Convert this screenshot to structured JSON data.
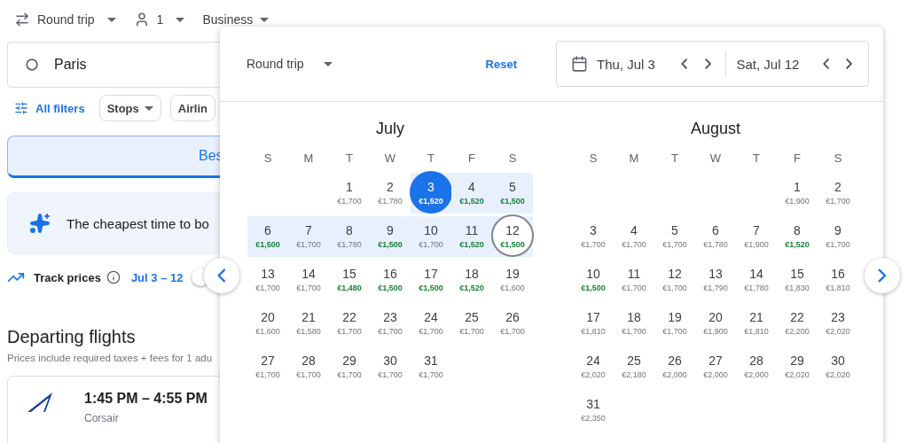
{
  "top_bar": {
    "trip_type": "Round trip",
    "passengers": "1",
    "cabin": "Business"
  },
  "search": {
    "origin": "Paris"
  },
  "filters": {
    "all_filters": "All filters",
    "chips": [
      "Stops",
      "Airlin"
    ]
  },
  "sort_tabs": [
    {
      "label": "Bes",
      "selected": true
    }
  ],
  "insight": {
    "text": "The cheapest time to bo"
  },
  "track": {
    "label": "Track prices",
    "dates": "Jul 3 – 12",
    "on": false
  },
  "departing": {
    "title": "Departing flights",
    "note": "Prices include required taxes + fees for 1 adu"
  },
  "flights": [
    {
      "times": "1:45 PM – 4:55 PM",
      "airline": "Corsair"
    }
  ],
  "dialog": {
    "trip_type": "Round trip",
    "reset": "Reset",
    "departure": "Thu, Jul 3",
    "return": "Sat, Jul 12",
    "months": [
      {
        "name": "July",
        "weekdays": [
          "S",
          "M",
          "T",
          "W",
          "T",
          "F",
          "S"
        ],
        "weeks": [
          {
            "leading_gap": true,
            "days": [
              {
                "day": "1",
                "price": "€1,700",
                "low": false,
                "in_range": false,
                "selected": false,
                "outlined": false
              },
              {
                "day": "2",
                "price": "€1,780",
                "low": false,
                "in_range": false,
                "selected": false,
                "outlined": false
              },
              {
                "day": "3",
                "price": "€1,520",
                "low": true,
                "in_range": true,
                "selected": true,
                "outlined": false
              },
              {
                "day": "4",
                "price": "€1,520",
                "low": true,
                "in_range": true,
                "selected": false,
                "outlined": false
              },
              {
                "day": "5",
                "price": "€1,500",
                "low": true,
                "in_range": true,
                "selected": false,
                "outlined": false
              }
            ]
          },
          {
            "days": [
              {
                "day": "6",
                "price": "€1,500",
                "low": true,
                "in_range": true,
                "selected": false,
                "outlined": false
              },
              {
                "day": "7",
                "price": "€1,700",
                "low": false,
                "in_range": true,
                "selected": false,
                "outlined": false
              },
              {
                "day": "8",
                "price": "€1,780",
                "low": false,
                "in_range": true,
                "selected": false,
                "outlined": false
              },
              {
                "day": "9",
                "price": "€1,500",
                "low": true,
                "in_range": true,
                "selected": false,
                "outlined": false
              },
              {
                "day": "10",
                "price": "€1,700",
                "low": false,
                "in_range": true,
                "selected": false,
                "outlined": false
              },
              {
                "day": "11",
                "price": "€1,520",
                "low": true,
                "in_range": true,
                "selected": false,
                "outlined": false
              },
              {
                "day": "12",
                "price": "€1,500",
                "low": true,
                "in_range": true,
                "selected": false,
                "outlined": true
              }
            ]
          },
          {
            "days": [
              {
                "day": "13",
                "price": "€1,700",
                "low": false,
                "in_range": false,
                "selected": false,
                "outlined": false
              },
              {
                "day": "14",
                "price": "€1,700",
                "low": false,
                "in_range": false,
                "selected": false,
                "outlined": false
              },
              {
                "day": "15",
                "price": "€1,480",
                "low": true,
                "in_range": false,
                "selected": false,
                "outlined": false
              },
              {
                "day": "16",
                "price": "€1,500",
                "low": true,
                "in_range": false,
                "selected": false,
                "outlined": false
              },
              {
                "day": "17",
                "price": "€1,500",
                "low": true,
                "in_range": false,
                "selected": false,
                "outlined": false
              },
              {
                "day": "18",
                "price": "€1,520",
                "low": true,
                "in_range": false,
                "selected": false,
                "outlined": false
              },
              {
                "day": "19",
                "price": "€1,600",
                "low": false,
                "in_range": false,
                "selected": false,
                "outlined": false
              }
            ]
          },
          {
            "days": [
              {
                "day": "20",
                "price": "€1,600",
                "low": false,
                "in_range": false,
                "selected": false,
                "outlined": false
              },
              {
                "day": "21",
                "price": "€1,580",
                "low": false,
                "in_range": false,
                "selected": false,
                "outlined": false
              },
              {
                "day": "22",
                "price": "€1,700",
                "low": false,
                "in_range": false,
                "selected": false,
                "outlined": false
              },
              {
                "day": "23",
                "price": "€1,700",
                "low": false,
                "in_range": false,
                "selected": false,
                "outlined": false
              },
              {
                "day": "24",
                "price": "€1,700",
                "low": false,
                "in_range": false,
                "selected": false,
                "outlined": false
              },
              {
                "day": "25",
                "price": "€1,700",
                "low": false,
                "in_range": false,
                "selected": false,
                "outlined": false
              },
              {
                "day": "26",
                "price": "€1,700",
                "low": false,
                "in_range": false,
                "selected": false,
                "outlined": false
              }
            ]
          },
          {
            "leading_gap": false,
            "days": [
              {
                "day": "27",
                "price": "€1,700",
                "low": false,
                "in_range": false,
                "selected": false,
                "outlined": false
              },
              {
                "day": "28",
                "price": "€1,700",
                "low": false,
                "in_range": false,
                "selected": false,
                "outlined": false
              },
              {
                "day": "29",
                "price": "€1,700",
                "low": false,
                "in_range": false,
                "selected": false,
                "outlined": false
              },
              {
                "day": "30",
                "price": "€1,700",
                "low": false,
                "in_range": false,
                "selected": false,
                "outlined": false
              },
              {
                "day": "31",
                "price": "€1,700",
                "low": false,
                "in_range": false,
                "selected": false,
                "outlined": false
              }
            ]
          }
        ]
      },
      {
        "name": "August",
        "weekdays": [
          "S",
          "M",
          "T",
          "W",
          "T",
          "F",
          "S"
        ],
        "weeks": [
          {
            "leading_gap": true,
            "days": [
              {
                "day": "1",
                "price": "€1,900",
                "low": false,
                "in_range": false,
                "selected": false,
                "outlined": false
              },
              {
                "day": "2",
                "price": "€1,700",
                "low": false,
                "in_range": false,
                "selected": false,
                "outlined": false
              }
            ]
          },
          {
            "days": [
              {
                "day": "3",
                "price": "€1,700",
                "low": false,
                "in_range": false,
                "selected": false,
                "outlined": false
              },
              {
                "day": "4",
                "price": "€1,700",
                "low": false,
                "in_range": false,
                "selected": false,
                "outlined": false
              },
              {
                "day": "5",
                "price": "€1,700",
                "low": false,
                "in_range": false,
                "selected": false,
                "outlined": false
              },
              {
                "day": "6",
                "price": "€1,780",
                "low": false,
                "in_range": false,
                "selected": false,
                "outlined": false
              },
              {
                "day": "7",
                "price": "€1,900",
                "low": false,
                "in_range": false,
                "selected": false,
                "outlined": false
              },
              {
                "day": "8",
                "price": "€1,520",
                "low": true,
                "in_range": false,
                "selected": false,
                "outlined": false
              },
              {
                "day": "9",
                "price": "€1,700",
                "low": false,
                "in_range": false,
                "selected": false,
                "outlined": false
              }
            ]
          },
          {
            "days": [
              {
                "day": "10",
                "price": "€1,500",
                "low": true,
                "in_range": false,
                "selected": false,
                "outlined": false
              },
              {
                "day": "11",
                "price": "€1,700",
                "low": false,
                "in_range": false,
                "selected": false,
                "outlined": false
              },
              {
                "day": "12",
                "price": "€1,700",
                "low": false,
                "in_range": false,
                "selected": false,
                "outlined": false
              },
              {
                "day": "13",
                "price": "€1,790",
                "low": false,
                "in_range": false,
                "selected": false,
                "outlined": false
              },
              {
                "day": "14",
                "price": "€1,780",
                "low": false,
                "in_range": false,
                "selected": false,
                "outlined": false
              },
              {
                "day": "15",
                "price": "€1,830",
                "low": false,
                "in_range": false,
                "selected": false,
                "outlined": false
              },
              {
                "day": "16",
                "price": "€1,810",
                "low": false,
                "in_range": false,
                "selected": false,
                "outlined": false
              }
            ]
          },
          {
            "days": [
              {
                "day": "17",
                "price": "€1,810",
                "low": false,
                "in_range": false,
                "selected": false,
                "outlined": false
              },
              {
                "day": "18",
                "price": "€1,700",
                "low": false,
                "in_range": false,
                "selected": false,
                "outlined": false
              },
              {
                "day": "19",
                "price": "€1,700",
                "low": false,
                "in_range": false,
                "selected": false,
                "outlined": false
              },
              {
                "day": "20",
                "price": "€1,900",
                "low": false,
                "in_range": false,
                "selected": false,
                "outlined": false
              },
              {
                "day": "21",
                "price": "€1,810",
                "low": false,
                "in_range": false,
                "selected": false,
                "outlined": false
              },
              {
                "day": "22",
                "price": "€2,200",
                "low": false,
                "in_range": false,
                "selected": false,
                "outlined": false
              },
              {
                "day": "23",
                "price": "€2,020",
                "low": false,
                "in_range": false,
                "selected": false,
                "outlined": false
              }
            ]
          },
          {
            "days": [
              {
                "day": "24",
                "price": "€2,020",
                "low": false,
                "in_range": false,
                "selected": false,
                "outlined": false
              },
              {
                "day": "25",
                "price": "€2,180",
                "low": false,
                "in_range": false,
                "selected": false,
                "outlined": false
              },
              {
                "day": "26",
                "price": "€2,000",
                "low": false,
                "in_range": false,
                "selected": false,
                "outlined": false
              },
              {
                "day": "27",
                "price": "€2,000",
                "low": false,
                "in_range": false,
                "selected": false,
                "outlined": false
              },
              {
                "day": "28",
                "price": "€2,000",
                "low": false,
                "in_range": false,
                "selected": false,
                "outlined": false
              },
              {
                "day": "29",
                "price": "€2,020",
                "low": false,
                "in_range": false,
                "selected": false,
                "outlined": false
              },
              {
                "day": "30",
                "price": "€2,020",
                "low": false,
                "in_range": false,
                "selected": false,
                "outlined": false
              }
            ]
          },
          {
            "leading_gap": false,
            "days": [
              {
                "day": "31",
                "price": "€2,350",
                "low": false,
                "in_range": false,
                "selected": false,
                "outlined": false
              }
            ]
          }
        ]
      }
    ]
  }
}
